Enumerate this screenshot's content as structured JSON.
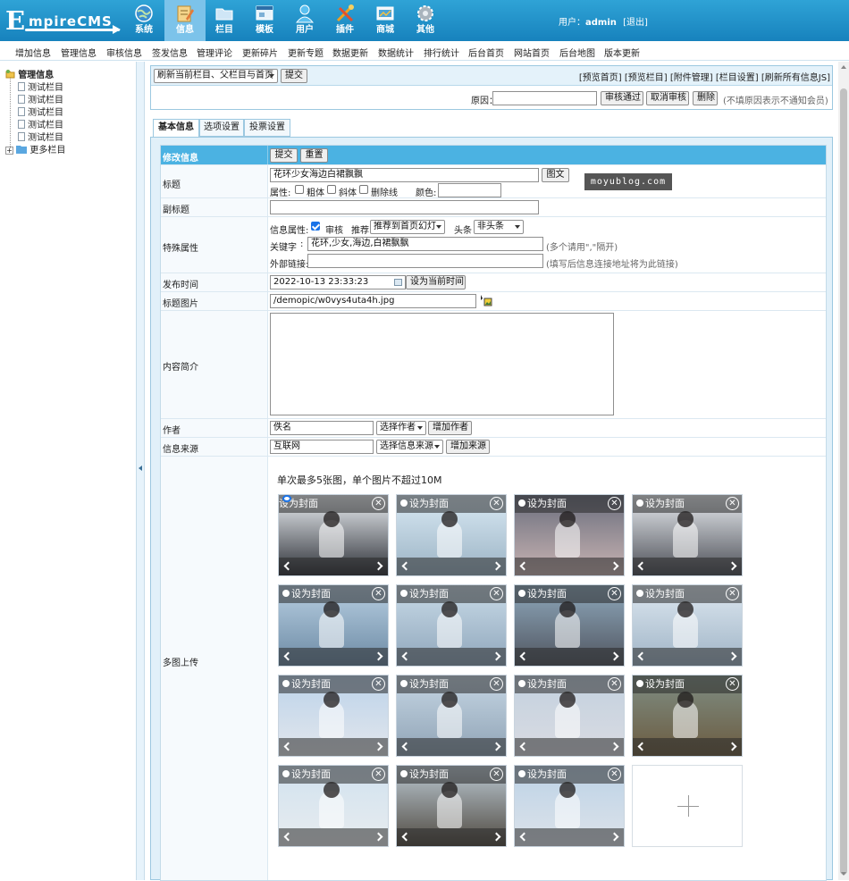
{
  "brand": {
    "logo_letter": "E",
    "logo_text": "mpireCMS"
  },
  "nav": [
    {
      "label": "系统",
      "icon": "globe-icon"
    },
    {
      "label": "信息",
      "icon": "edit-document-icon"
    },
    {
      "label": "栏目",
      "icon": "folder-icon"
    },
    {
      "label": "模板",
      "icon": "template-window-icon"
    },
    {
      "label": "用户",
      "icon": "user-icon"
    },
    {
      "label": "插件",
      "icon": "tools-icon"
    },
    {
      "label": "商城",
      "icon": "shop-icon"
    },
    {
      "label": "其他",
      "icon": "gear-icon"
    }
  ],
  "user": {
    "prefix": "用户：",
    "name": "admin",
    "logout": "[退出]"
  },
  "submenu": [
    "增加信息",
    "管理信息",
    "审核信息",
    "签发信息",
    "管理评论",
    "更新碎片",
    "更新专题",
    "数据更新",
    "数据统计",
    "排行统计",
    "后台首页",
    "网站首页",
    "后台地图",
    "版本更新"
  ],
  "tree": {
    "root": "管理信息",
    "items": [
      "测试栏目",
      "测试栏目",
      "测试栏目",
      "测试栏目",
      "测试栏目"
    ],
    "more": "更多栏目"
  },
  "actionbar": {
    "refresh_select": "刷新当前栏目、父栏目与首页",
    "submit": "提交",
    "links": [
      "[预览首页]",
      "[预览栏目]",
      "[附件管理]",
      "[栏目设置]",
      "[刷新所有信息JS]"
    ],
    "reason_label": "原因：",
    "reason_value": "",
    "approve": "审核通过",
    "unapprove": "取消审核",
    "delete": "删除",
    "note": "(不填原因表示不通知会员)"
  },
  "tabs": [
    "基本信息",
    "选项设置",
    "投票设置"
  ],
  "form": {
    "header_label": "修改信息",
    "submit": "提交",
    "reset": "重置",
    "title_label": "标题",
    "title_value": "花环少女海边白裙飘飘",
    "title_pic_btn": "图文",
    "attr_label": "属性:",
    "bold": "粗体",
    "italic": "斜体",
    "strike": "删除线",
    "color_label": "颜色:",
    "color_value": "",
    "subtitle_label": "副标题",
    "subtitle_value": "",
    "special_label": "特殊属性",
    "info_attr_label": "信息属性:",
    "audit": "审核",
    "recommend_label": "推荐",
    "recommend_value": "推荐到首页幻灯",
    "headline_label": "头条",
    "headline_value": "非头条",
    "keywords_label": "关键字",
    "keywords_value": "花环,少女,海边,白裙飘飘",
    "keywords_hint": "(多个请用\",\"隔开)",
    "external_label": "外部链接:",
    "external_value": "",
    "external_hint": "(填写后信息连接地址将为此链接)",
    "pubtime_label": "发布时间",
    "pubtime_value": "2022-10-13 23:33:23",
    "set_now": "设为当前时间",
    "titlepic_label": "标题图片",
    "titlepic_value": "/demopic/w0vys4uta4h.jpg",
    "summary_label": "内容简介",
    "summary_value": "",
    "author_label": "作者",
    "author_value": "佚名",
    "author_select": "选择作者",
    "author_add": "增加作者",
    "source_label": "信息来源",
    "source_value": "互联网",
    "source_select": "选择信息来源",
    "source_add": "增加来源",
    "multi_label": "多图上传",
    "multi_note": "单次最多5张图，单个图片不超过10M"
  },
  "gallery": {
    "cover_label": "设为封面",
    "close_glyph": "✕",
    "items": [
      {
        "top": "#eef2f6",
        "bottom": "#2c2f36"
      },
      {
        "top": "#d9e9f4",
        "bottom": "#9bb3c4"
      },
      {
        "top": "#6a6e7d",
        "bottom": "#c9b4b3"
      },
      {
        "top": "#e9edf1",
        "bottom": "#4b4d55"
      },
      {
        "top": "#b8cfe2",
        "bottom": "#6c8aa4"
      },
      {
        "top": "#c9dbe8",
        "bottom": "#8fa6bb"
      },
      {
        "top": "#8fa9bd",
        "bottom": "#50555f"
      },
      {
        "top": "#dde7f0",
        "bottom": "#9fb4c6"
      },
      {
        "top": "#bcd3ea",
        "bottom": "#e2e6ec"
      },
      {
        "top": "#c6d6e4",
        "bottom": "#8fa3b5"
      },
      {
        "top": "#c3d1df",
        "bottom": "#d9dbe2"
      },
      {
        "top": "#7f8e84",
        "bottom": "#6b5b40"
      },
      {
        "top": "#d1e2ef",
        "bottom": "#e8ecef"
      },
      {
        "top": "#bcc9d3",
        "bottom": "#4f4940"
      },
      {
        "top": "#bcd2e6",
        "bottom": "#dde3ea"
      }
    ]
  },
  "watermark": "moyublog.com"
}
